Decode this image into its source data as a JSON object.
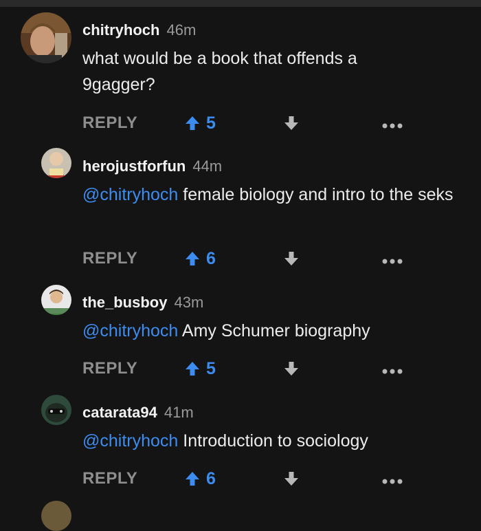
{
  "comments": [
    {
      "username": "chitryhoch",
      "time": "46m",
      "mention": "",
      "text": "what would be a book that offends a 9gagger?",
      "reply_label": "REPLY",
      "upvotes": "5"
    },
    {
      "username": "herojustforfun",
      "time": "44m",
      "mention": "@chitryhoch",
      "text": " female biology and intro to the seks",
      "reply_label": "REPLY",
      "upvotes": "6"
    },
    {
      "username": "the_busboy",
      "time": "43m",
      "mention": "@chitryhoch",
      "text": " Amy Schumer biography",
      "reply_label": "REPLY",
      "upvotes": "5"
    },
    {
      "username": "catarata94",
      "time": "41m",
      "mention": "@chitryhoch",
      "text": " Introduction to sociology",
      "reply_label": "REPLY",
      "upvotes": "6"
    }
  ],
  "colors": {
    "background": "#141414",
    "accent": "#3d8cf0",
    "muted": "#8e8e8e"
  },
  "icons": {
    "upvote": "arrow-up-icon",
    "downvote": "arrow-down-icon",
    "more": "more-dots-icon"
  }
}
